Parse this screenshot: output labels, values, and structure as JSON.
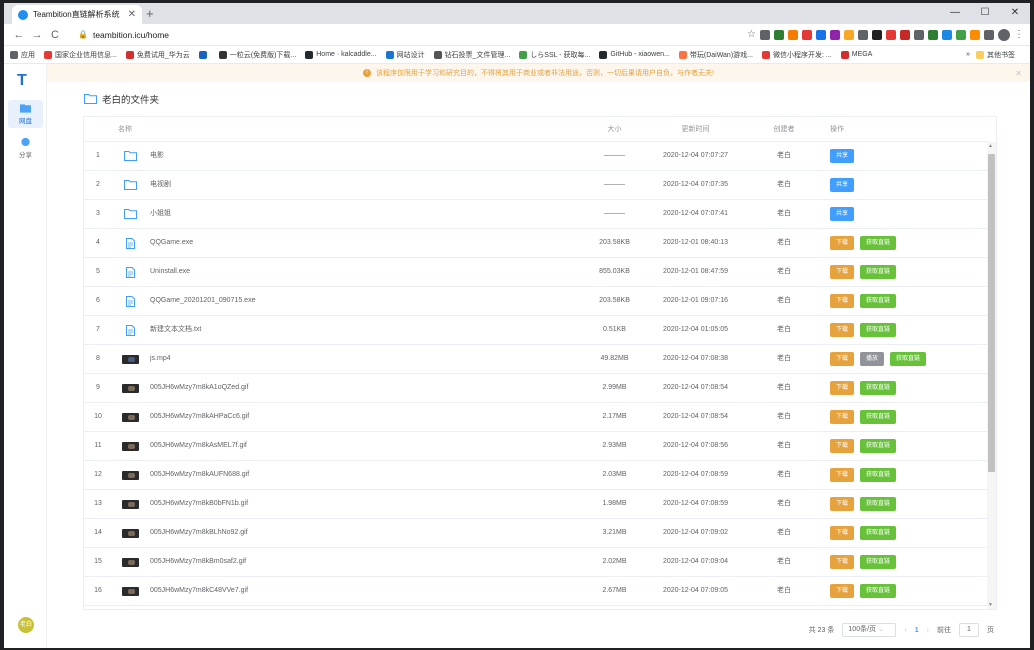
{
  "browser": {
    "tab_title": "Teambition直链解析系统",
    "tab_close": "✕",
    "new_tab": "+",
    "url": "teambition.icu/home",
    "window_controls": [
      "—",
      "☐",
      "✕"
    ],
    "bookmarks": [
      {
        "label": "应用",
        "color": "#5f6368"
      },
      {
        "label": "国家企业信用信息...",
        "color": "#e53935"
      },
      {
        "label": "免费试用_华为云",
        "color": "#d32f2f"
      },
      {
        "label": "",
        "color": "#1565c0"
      },
      {
        "label": "一粒云(免费版)下载...",
        "color": "#333333"
      },
      {
        "label": "Home · kalcaddle...",
        "color": "#24292e"
      },
      {
        "label": "网站设计",
        "color": "#1976d2"
      },
      {
        "label": "钻石投票_文件管理...",
        "color": "#555555"
      },
      {
        "label": "しらSSL - 获取每...",
        "color": "#43a047"
      },
      {
        "label": "GitHub - xiaowen...",
        "color": "#24292e"
      },
      {
        "label": "带玩(DaiWan)游戏...",
        "color": "#ff7043"
      },
      {
        "label": "微信小程序开发: ...",
        "color": "#e53935"
      },
      {
        "label": "MEGA",
        "color": "#d32f2f"
      }
    ],
    "bookmarks_more": "»",
    "other_bookmarks": "其他书签",
    "extensions": [
      "#5f6368",
      "#2e7d32",
      "#f57c00",
      "#e53935",
      "#1a73e8",
      "#8e24aa",
      "#f9a825",
      "#5f6368",
      "#212121",
      "#e53935",
      "#c62828",
      "#5f6368",
      "#2e7d32",
      "#1e88e5",
      "#43a047",
      "#fb8c00",
      "#5f6368"
    ]
  },
  "app": {
    "logo": "T",
    "sidebar": [
      {
        "label": "网盘",
        "active": true
      },
      {
        "label": "分享",
        "active": false
      }
    ],
    "user_avatar": "老白",
    "notice": "该程序仅限用于学习和研究目的，不得将其用于商业或者非法用途，否则，一切后果请用户自负，与作者无关!",
    "notice_close": "✕",
    "folder_title": "老白的文件夹",
    "columns": [
      "名称",
      "大小",
      "更新时间",
      "创建者",
      "操作"
    ],
    "rows": [
      {
        "idx": "1",
        "name": "电影",
        "type": "folder",
        "size": "———",
        "time": "2020-12-04 07:07:27",
        "owner": "老白",
        "ops": [
          "共享"
        ]
      },
      {
        "idx": "2",
        "name": "电视剧",
        "type": "folder",
        "size": "———",
        "time": "2020-12-04 07:07:35",
        "owner": "老白",
        "ops": [
          "共享"
        ]
      },
      {
        "idx": "3",
        "name": "小姐姐",
        "type": "folder",
        "size": "———",
        "time": "2020-12-04 07:07:41",
        "owner": "老白",
        "ops": [
          "共享"
        ]
      },
      {
        "idx": "4",
        "name": "QQGame.exe",
        "type": "file",
        "size": "203.58KB",
        "time": "2020-12-01 08:40:13",
        "owner": "老白",
        "ops": [
          "下载",
          "获取直链"
        ]
      },
      {
        "idx": "5",
        "name": "Uninstall.exe",
        "type": "file",
        "size": "855.03KB",
        "time": "2020-12-01 08:47:59",
        "owner": "老白",
        "ops": [
          "下载",
          "获取直链"
        ]
      },
      {
        "idx": "6",
        "name": "QQGame_20201201_090715.exe",
        "type": "file",
        "size": "203.58KB",
        "time": "2020-12-01 09:07:16",
        "owner": "老白",
        "ops": [
          "下载",
          "获取直链"
        ]
      },
      {
        "idx": "7",
        "name": "新建文本文档.txt",
        "type": "file",
        "size": "0.51KB",
        "time": "2020-12-04 01:05:05",
        "owner": "老白",
        "ops": [
          "下载",
          "获取直链"
        ]
      },
      {
        "idx": "8",
        "name": "js.mp4",
        "type": "video",
        "size": "49.82MB",
        "time": "2020-12-04 07:08:38",
        "owner": "老白",
        "ops": [
          "下载",
          "播放",
          "获取直链"
        ]
      },
      {
        "idx": "9",
        "name": "005JH6wMzy7m8kA1oQZed.gif",
        "type": "image",
        "size": "2.99MB",
        "time": "2020-12-04 07:08:54",
        "owner": "老白",
        "ops": [
          "下载",
          "获取直链"
        ]
      },
      {
        "idx": "10",
        "name": "005JH6wMzy7m8kAHPaCc6.gif",
        "type": "image",
        "size": "2.17MB",
        "time": "2020-12-04 07:08:54",
        "owner": "老白",
        "ops": [
          "下载",
          "获取直链"
        ]
      },
      {
        "idx": "11",
        "name": "005JH6wMzy7m8kAsMEL7f.gif",
        "type": "image",
        "size": "2.93MB",
        "time": "2020-12-04 07:08:56",
        "owner": "老白",
        "ops": [
          "下载",
          "获取直链"
        ]
      },
      {
        "idx": "12",
        "name": "005JH6wMzy7m8kAUFN688.gif",
        "type": "image",
        "size": "2.03MB",
        "time": "2020-12-04 07:08:59",
        "owner": "老白",
        "ops": [
          "下载",
          "获取直链"
        ]
      },
      {
        "idx": "13",
        "name": "005JH6wMzy7m8kB0bFN1b.gif",
        "type": "image",
        "size": "1.98MB",
        "time": "2020-12-04 07:08:59",
        "owner": "老白",
        "ops": [
          "下载",
          "获取直链"
        ]
      },
      {
        "idx": "14",
        "name": "005JH6wMzy7m8kBLhNo92.gif",
        "type": "image",
        "size": "3.21MB",
        "time": "2020-12-04 07:09:02",
        "owner": "老白",
        "ops": [
          "下载",
          "获取直链"
        ]
      },
      {
        "idx": "15",
        "name": "005JH6wMzy7m8kBm0saf2.gif",
        "type": "image",
        "size": "2.02MB",
        "time": "2020-12-04 07:09:04",
        "owner": "老白",
        "ops": [
          "下载",
          "获取直链"
        ]
      },
      {
        "idx": "16",
        "name": "005JH6wMzy7m8kC48VVe7.gif",
        "type": "image",
        "size": "2.67MB",
        "time": "2020-12-04 07:09:05",
        "owner": "老白",
        "ops": [
          "下载",
          "获取直链"
        ]
      }
    ],
    "pagination": {
      "total": "共 23 条",
      "page_size": "100条/页",
      "prev": "‹",
      "current": "1",
      "next": "›",
      "goto_label": "前往",
      "goto_value": "1",
      "page_unit": "页"
    },
    "colors": {
      "share": "#409eff",
      "download": "#e6a23c",
      "link": "#67c23a",
      "play": "#909399",
      "accent": "#1e6fd9"
    }
  }
}
